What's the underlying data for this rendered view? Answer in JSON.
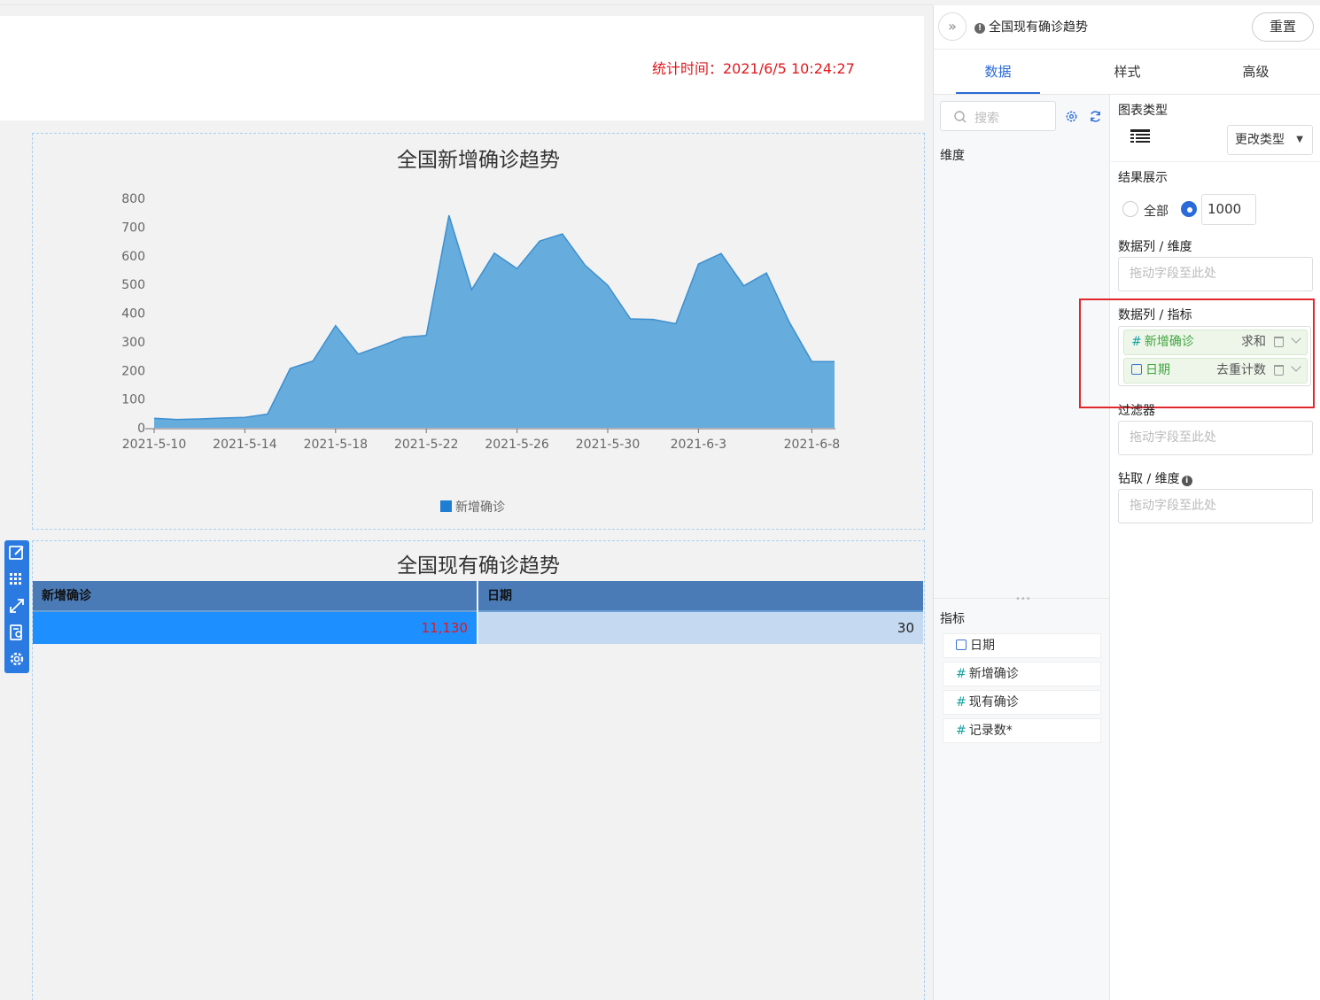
{
  "dashboard": {
    "stat_time": "统计时间：2021/6/5 10:24:27"
  },
  "chart1": {
    "legend": "新增确诊"
  },
  "chart_data": {
    "type": "area",
    "title": "全国新增确诊趋势",
    "xlabel": "",
    "ylabel": "",
    "ylim": [
      0,
      800
    ],
    "yticks": [
      "0",
      "100",
      "200",
      "300",
      "400",
      "500",
      "600",
      "700",
      "800"
    ],
    "xtick_labels": [
      "2021-5-10",
      "2021-5-14",
      "2021-5-18",
      "2021-5-22",
      "2021-5-26",
      "2021-5-30",
      "2021-6-3",
      "2021-6-8"
    ],
    "xtick_index": [
      0,
      4,
      8,
      12,
      16,
      20,
      24,
      29
    ],
    "grid": false,
    "legend_position": "bottom",
    "series": [
      {
        "name": "新增确诊",
        "color": "#66acdc",
        "line_color": "#3d8fd0",
        "values": [
          33,
          29,
          31,
          34,
          36,
          48,
          207,
          233,
          356,
          257,
          285,
          316,
          322,
          741,
          482,
          609,
          555,
          651,
          676,
          567,
          497,
          380,
          378,
          363,
          571,
          608,
          495,
          540,
          369,
          231,
          231
        ]
      }
    ]
  },
  "table_chart": {
    "title": "全国现有确诊趋势",
    "headers": [
      "新增确诊",
      "日期"
    ],
    "row": [
      "11,130",
      "30"
    ]
  },
  "sidebar": {
    "title": "全国现有确诊趋势",
    "reset": "重置",
    "tabs": [
      "数据",
      "样式",
      "高级"
    ],
    "search_placeholder": "搜索",
    "dimension_label": "维度",
    "measure_label": "指标",
    "measure_fields": [
      "日期",
      "新增确诊",
      "现有确诊",
      "记录数*"
    ],
    "chart_type_label": "图表类型",
    "change_type": "更改类型",
    "result_label": "结果展示",
    "result_all": "全部",
    "result_limit": "1000",
    "col_dim_label": "数据列 / 维度",
    "dropzone_hint": "拖动字段至此处",
    "col_measure_label": "数据列 / 指标",
    "measure_pills": [
      {
        "name": "新增确诊",
        "agg": "求和"
      },
      {
        "name": "日期",
        "agg": "去重计数"
      }
    ],
    "filter_label": "过滤器",
    "drill_label": "钻取 / 维度"
  },
  "colors": {
    "accent": "#2a6ad9",
    "stat_time": "#e0191e",
    "header_row": "#4a7bb7",
    "cell_left": "#1e8fff",
    "cell_right": "#c5d9f1",
    "highlight": "#e0282e"
  }
}
